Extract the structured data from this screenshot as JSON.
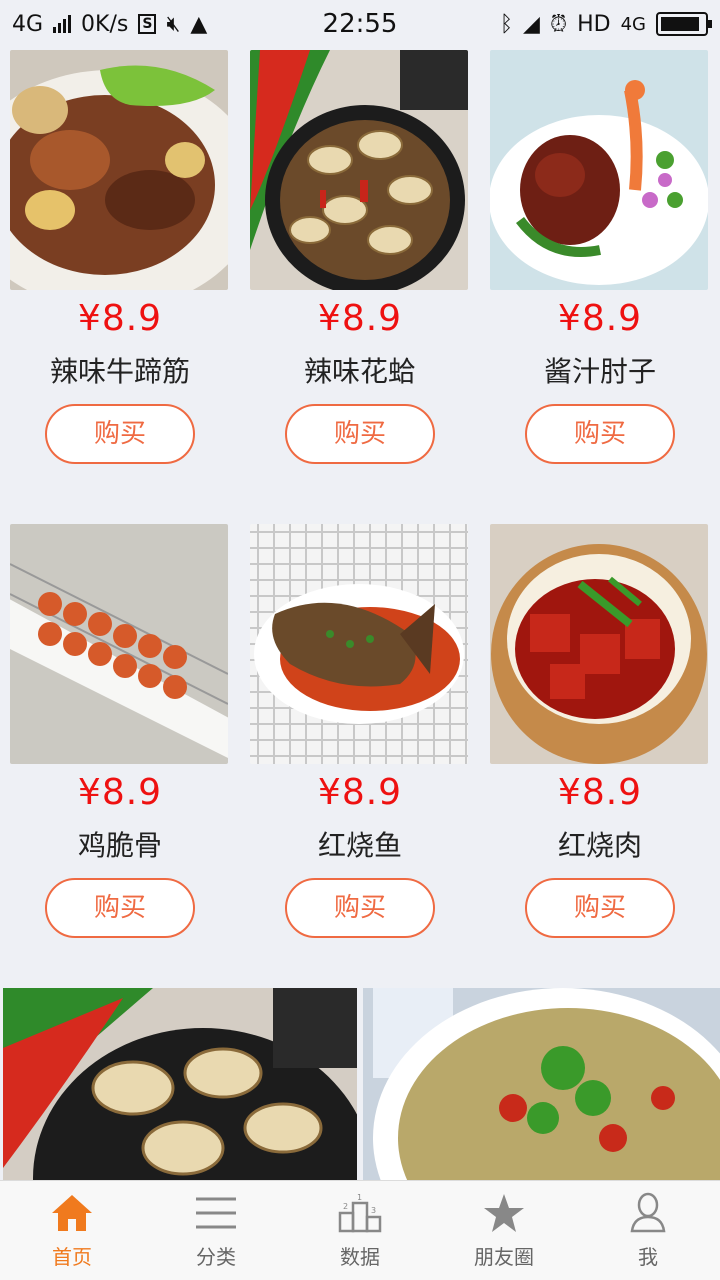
{
  "status_bar": {
    "network": "4G",
    "speed": "0K/s",
    "time": "22:55",
    "hd": "HD",
    "network_right": "4G"
  },
  "products": [
    {
      "price": "¥8.9",
      "name": "辣味牛蹄筋",
      "buy_label": "购买",
      "image_icon": "beef-tendon-dish"
    },
    {
      "price": "¥8.9",
      "name": "辣味花蛤",
      "buy_label": "购买",
      "image_icon": "clam-dish"
    },
    {
      "price": "¥8.9",
      "name": "酱汁肘子",
      "buy_label": "购买",
      "image_icon": "pork-knuckle-dish"
    },
    {
      "price": "¥8.9",
      "name": "鸡脆骨",
      "buy_label": "购买",
      "image_icon": "chicken-skewer-dish"
    },
    {
      "price": "¥8.9",
      "name": "红烧鱼",
      "buy_label": "购买",
      "image_icon": "braised-fish-dish"
    },
    {
      "price": "¥8.9",
      "name": "红烧肉",
      "buy_label": "购买",
      "image_icon": "braised-pork-dish"
    }
  ],
  "banner": {
    "slides": [
      "clam-dish",
      "fish-soup-dish"
    ]
  },
  "tabs": [
    {
      "label": "首页",
      "icon": "home-icon",
      "active": true
    },
    {
      "label": "分类",
      "icon": "menu-lines-icon",
      "active": false
    },
    {
      "label": "数据",
      "icon": "podium-icon",
      "active": false
    },
    {
      "label": "朋友圈",
      "icon": "star-icon",
      "active": false
    },
    {
      "label": "我",
      "icon": "person-icon",
      "active": false
    }
  ],
  "colors": {
    "price": "#ee1111",
    "accent": "#ef6a42",
    "tab_active": "#f07a1e",
    "background": "#eef0f5"
  }
}
